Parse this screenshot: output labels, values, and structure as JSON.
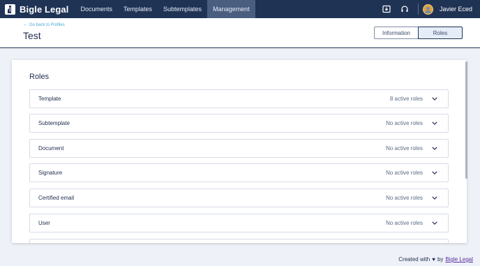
{
  "navbar": {
    "brand": "Bigle Legal",
    "links": [
      {
        "label": "Documents"
      },
      {
        "label": "Templates"
      },
      {
        "label": "Subtemplates"
      },
      {
        "label": "Management"
      }
    ],
    "active_link": "Management",
    "user_name": "Javier Eced",
    "icons": [
      "download-box-icon",
      "headset-icon",
      "user-avatar"
    ]
  },
  "header": {
    "back_link": "Go back to Profiles",
    "title": "Test",
    "tabs": [
      {
        "label": "Information"
      },
      {
        "label": "Roles"
      }
    ],
    "active_tab": "Roles"
  },
  "roles": {
    "title": "Roles",
    "items": [
      {
        "name": "Template",
        "status": "8 active roles"
      },
      {
        "name": "Subtemplate",
        "status": "No active roles"
      },
      {
        "name": "Document",
        "status": "No active roles"
      },
      {
        "name": "Signature",
        "status": "No active roles"
      },
      {
        "name": "Certified email",
        "status": "No active roles"
      },
      {
        "name": "User",
        "status": "No active roles"
      }
    ]
  },
  "footer": {
    "prefix": "Created with",
    "by": "by",
    "link": "Bigle Legal"
  },
  "colors": {
    "navbar_bg": "#1f3355",
    "active_nav_bg": "#4a5e80",
    "accent_link": "#4aa8d8",
    "footer_link": "#5a2d9c"
  }
}
